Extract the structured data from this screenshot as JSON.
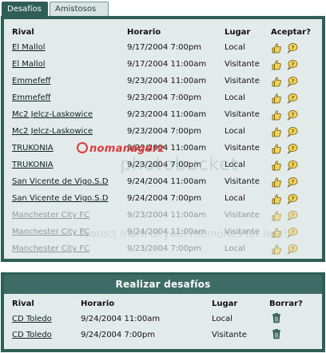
{
  "tabs": [
    {
      "label": "Desafíos",
      "active": true
    },
    {
      "label": "Amistosos",
      "active": false
    }
  ],
  "challenges": {
    "headers": {
      "rival": "Rival",
      "time": "Horario",
      "place": "Lugar",
      "accept": "Aceptar?"
    },
    "rows": [
      {
        "rival": "El Mallol",
        "time": "9/17/2004 7:00pm",
        "place": "Local",
        "faded": false
      },
      {
        "rival": "El Mallol",
        "time": "9/17/2004 11:00am",
        "place": "Visitante",
        "faded": false
      },
      {
        "rival": "Emmefeff",
        "time": "9/23/2004 11:00am",
        "place": "Visitante",
        "faded": false
      },
      {
        "rival": "Emmefeff",
        "time": "9/23/2004 7:00pm",
        "place": "Local",
        "faded": false
      },
      {
        "rival": "Mc2 Jelcz-Laskowice",
        "time": "9/23/2004 11:00am",
        "place": "Visitante",
        "faded": false
      },
      {
        "rival": "Mc2 Jelcz-Laskowice",
        "time": "9/23/2004 7:00pm",
        "place": "Local",
        "faded": false
      },
      {
        "rival": "TRUKONIA",
        "time": "9/23/2004 11:00am",
        "place": "Visitante",
        "faded": false
      },
      {
        "rival": "TRUKONIA",
        "time": "9/23/2004 7:00pm",
        "place": "Local",
        "faded": false
      },
      {
        "rival": "San Vicente de Vigo.S.D",
        "time": "9/24/2004 11:00am",
        "place": "Visitante",
        "faded": false
      },
      {
        "rival": "San Vicente de Vigo.S.D",
        "time": "9/24/2004 7:00pm",
        "place": "Local",
        "faded": false
      },
      {
        "rival": "Manchester City FC",
        "time": "9/23/2004 11:00am",
        "place": "Visitante",
        "faded": true
      },
      {
        "rival": "Manchester City FC",
        "time": "9/24/2004 11:00am",
        "place": "Visitante",
        "faded": true
      },
      {
        "rival": "Manchester City FC",
        "time": "9/23/2004 7:00pm",
        "place": "Local",
        "faded": true
      }
    ]
  },
  "made": {
    "title": "Realizar desafíos",
    "headers": {
      "rival": "Rival",
      "time": "Horario",
      "place": "Lugar",
      "delete": "Borrar?"
    },
    "rows": [
      {
        "rival": "CD Toledo",
        "time": "9/24/2004 11:00am",
        "place": "Local"
      },
      {
        "rival": "CD Toledo",
        "time": "9/24/2004 7:00pm",
        "place": "Visitante"
      }
    ]
  },
  "watermark": {
    "logo": "nomanagerz",
    "text": "photobucket",
    "sub": "Protect more of your memories for less!"
  },
  "colors": {
    "panel_border": "#2f5e58",
    "panel_bg": "#e3ebea",
    "accept_icon": "#c7a21c",
    "delete_icon": "#2f5e58"
  },
  "icons": {
    "accept": "thumbs-up-icon",
    "reply": "speech-bubble-icon",
    "delete": "trash-icon"
  }
}
